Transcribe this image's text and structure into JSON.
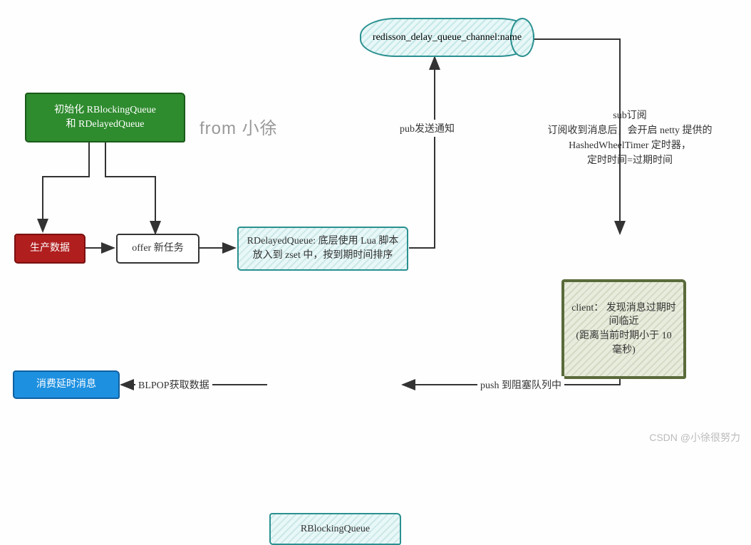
{
  "watermarks": {
    "from": "from 小徐",
    "csdn": "CSDN @小徐很努力"
  },
  "nodes": {
    "init": "初始化 RBlockingQueue\n和 RDelayedQueue",
    "produce": "生产数据",
    "offer": "offer 新任务",
    "delayed_queue": "RDelayedQueue: 底层使用 Lua 脚本放入到 zset 中，按到期时间排序",
    "channel": "redisson_delay_queue_channel:name",
    "client": "client： 发现消息过期时间临近\n(距离当前时期小于 10 毫秒)",
    "blocking_queue": "RBlockingQueue",
    "consume": "消费延时消息"
  },
  "edges": {
    "pub": "pub发送通知",
    "sub": "sub订阅\n订阅收到消息后，会开启 netty 提供的\nHashedWheelTimer 定时器，\n定时时间=过期时间",
    "push": "push 到阻塞队列中",
    "blpop": "BLPOP获取数据"
  }
}
